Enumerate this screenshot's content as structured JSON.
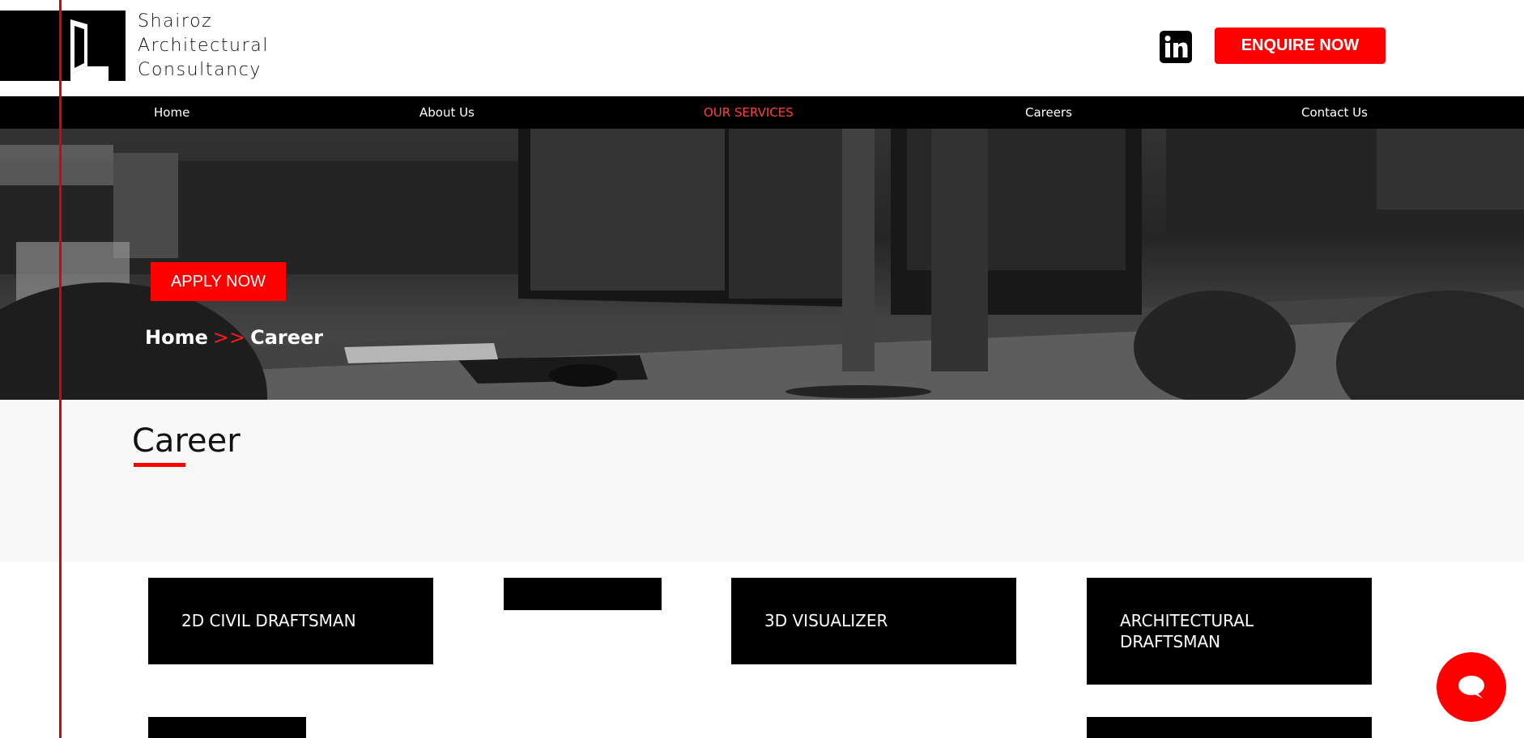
{
  "brand": {
    "line1": "Shairoz",
    "line2": "Architectural",
    "line3": "Consultancy"
  },
  "header": {
    "enquire_label": "ENQUIRE NOW",
    "linkedin_icon": "linkedin-icon"
  },
  "nav": {
    "items": [
      {
        "label": "Home"
      },
      {
        "label": "About Us"
      },
      {
        "label": "OUR SERVICES"
      },
      {
        "label": "Careers"
      },
      {
        "label": "Contact Us"
      }
    ],
    "active_color": "#ff4040"
  },
  "hero": {
    "apply_label": "APPLY NOW",
    "breadcrumb_home": "Home",
    "breadcrumb_sep": ">>",
    "breadcrumb_current": "Career"
  },
  "career": {
    "title": "Career"
  },
  "jobs": [
    {
      "title": "2D CIVIL DRAFTSMAN"
    },
    {
      "title": ""
    },
    {
      "title": "3D VISUALIZER"
    },
    {
      "title": "ARCHITECTURAL DRAFTSMAN"
    },
    {
      "title": ""
    },
    {
      "title": ""
    }
  ],
  "colors": {
    "accent": "#ff0000",
    "nav_bg": "#000000",
    "section_bg": "#f8f8f8"
  },
  "chat": {
    "icon": "chat-bubble-icon"
  }
}
